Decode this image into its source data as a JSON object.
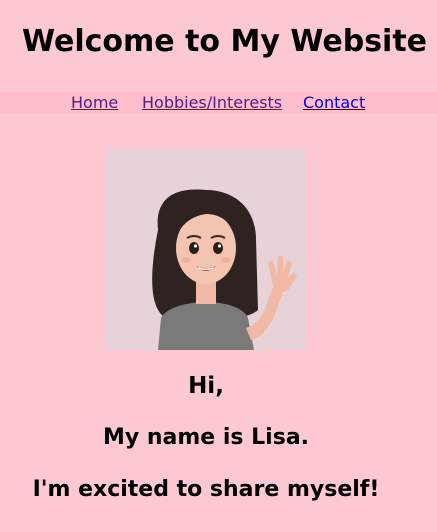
{
  "header": {
    "title": "Welcome to My Website"
  },
  "nav": {
    "items": [
      {
        "label": "Home"
      },
      {
        "label": "Hobbies/Interests"
      },
      {
        "label": "Contact"
      }
    ]
  },
  "profile": {
    "image": "waving-girl-avatar",
    "greeting": "Hi,",
    "name_line": "My name is Lisa.",
    "tagline": "I'm excited to share myself!"
  },
  "colors": {
    "page_background": "#fcc8d2",
    "nav_background": "#ffbecc",
    "visited_link": "#551a8b",
    "link": "#0000ee"
  }
}
